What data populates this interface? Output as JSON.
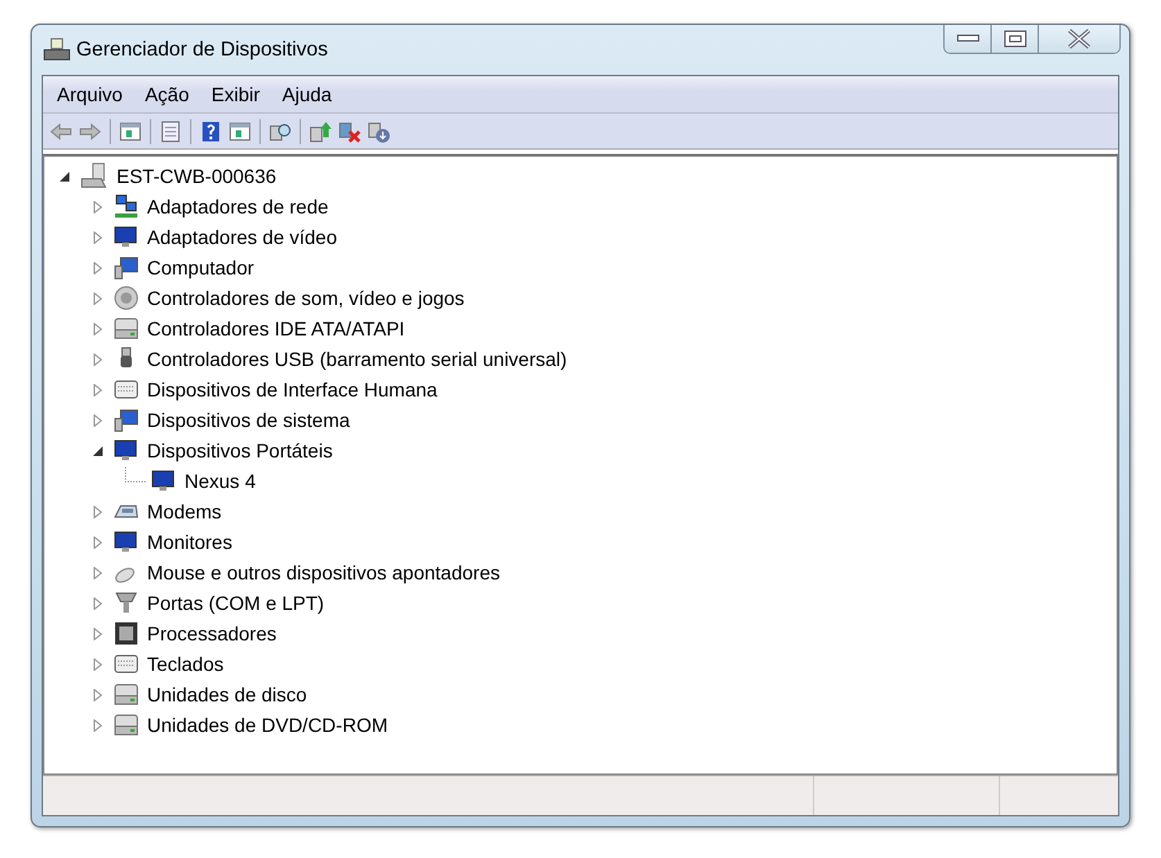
{
  "window": {
    "title": "Gerenciador de Dispositivos"
  },
  "menu": [
    "Arquivo",
    "Ação",
    "Exibir",
    "Ajuda"
  ],
  "tree": {
    "label": "EST-CWB-000636",
    "expanded": true,
    "children": [
      {
        "label": "Adaptadores de rede",
        "expanded": false
      },
      {
        "label": "Adaptadores de vídeo",
        "expanded": false
      },
      {
        "label": "Computador",
        "expanded": false
      },
      {
        "label": "Controladores de som, vídeo e jogos",
        "expanded": false
      },
      {
        "label": "Controladores IDE ATA/ATAPI",
        "expanded": false
      },
      {
        "label": "Controladores USB (barramento serial universal)",
        "expanded": false
      },
      {
        "label": "Dispositivos de Interface Humana",
        "expanded": false
      },
      {
        "label": "Dispositivos de sistema",
        "expanded": false
      },
      {
        "label": "Dispositivos Portáteis",
        "expanded": true,
        "children": [
          {
            "label": "Nexus 4"
          }
        ]
      },
      {
        "label": "Modems",
        "expanded": false
      },
      {
        "label": "Monitores",
        "expanded": false
      },
      {
        "label": "Mouse e outros dispositivos apontadores",
        "expanded": false
      },
      {
        "label": "Portas (COM e LPT)",
        "expanded": false
      },
      {
        "label": "Processadores",
        "expanded": false
      },
      {
        "label": "Teclados",
        "expanded": false
      },
      {
        "label": "Unidades de disco",
        "expanded": false
      },
      {
        "label": "Unidades de DVD/CD-ROM",
        "expanded": false
      }
    ]
  }
}
